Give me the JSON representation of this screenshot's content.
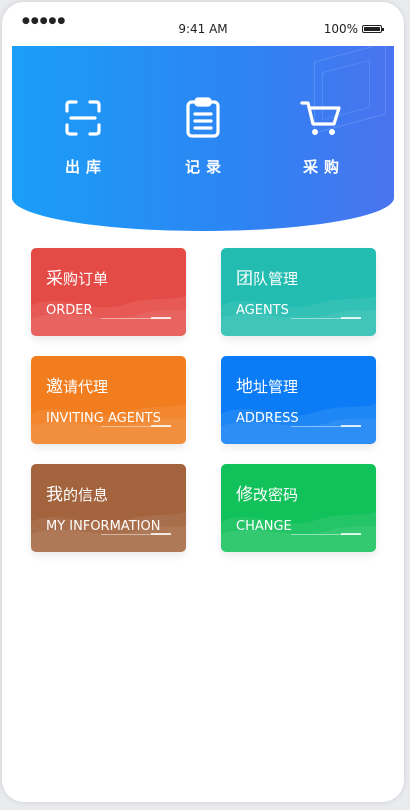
{
  "status": {
    "signal": "●●●●●",
    "time": "9:41 AM",
    "battery": "100%"
  },
  "actions": [
    {
      "label": "出库",
      "icon": "scan-icon"
    },
    {
      "label": "记录",
      "icon": "clipboard-icon"
    },
    {
      "label": "采购",
      "icon": "cart-icon"
    }
  ],
  "cards": [
    {
      "title_big": "采",
      "title_rest": "购订单",
      "sub": "ORDER",
      "color": "#e54b46"
    },
    {
      "title_big": "团",
      "title_rest": "队管理",
      "sub": "AGENTS",
      "color": "#22bcb0"
    },
    {
      "title_big": "邀",
      "title_rest": "请代理",
      "sub": "INVITING AGENTS",
      "color": "#f17d1f"
    },
    {
      "title_big": "地",
      "title_rest": "址管理",
      "sub": "ADDRESS",
      "color": "#0b7cf5"
    },
    {
      "title_big": "我",
      "title_rest": "的信息",
      "sub": "MY INFORMATION",
      "color": "#a2633d"
    },
    {
      "title_big": "修",
      "title_rest": "改密码",
      "sub": "CHANGE",
      "color": "#11c15a"
    }
  ]
}
